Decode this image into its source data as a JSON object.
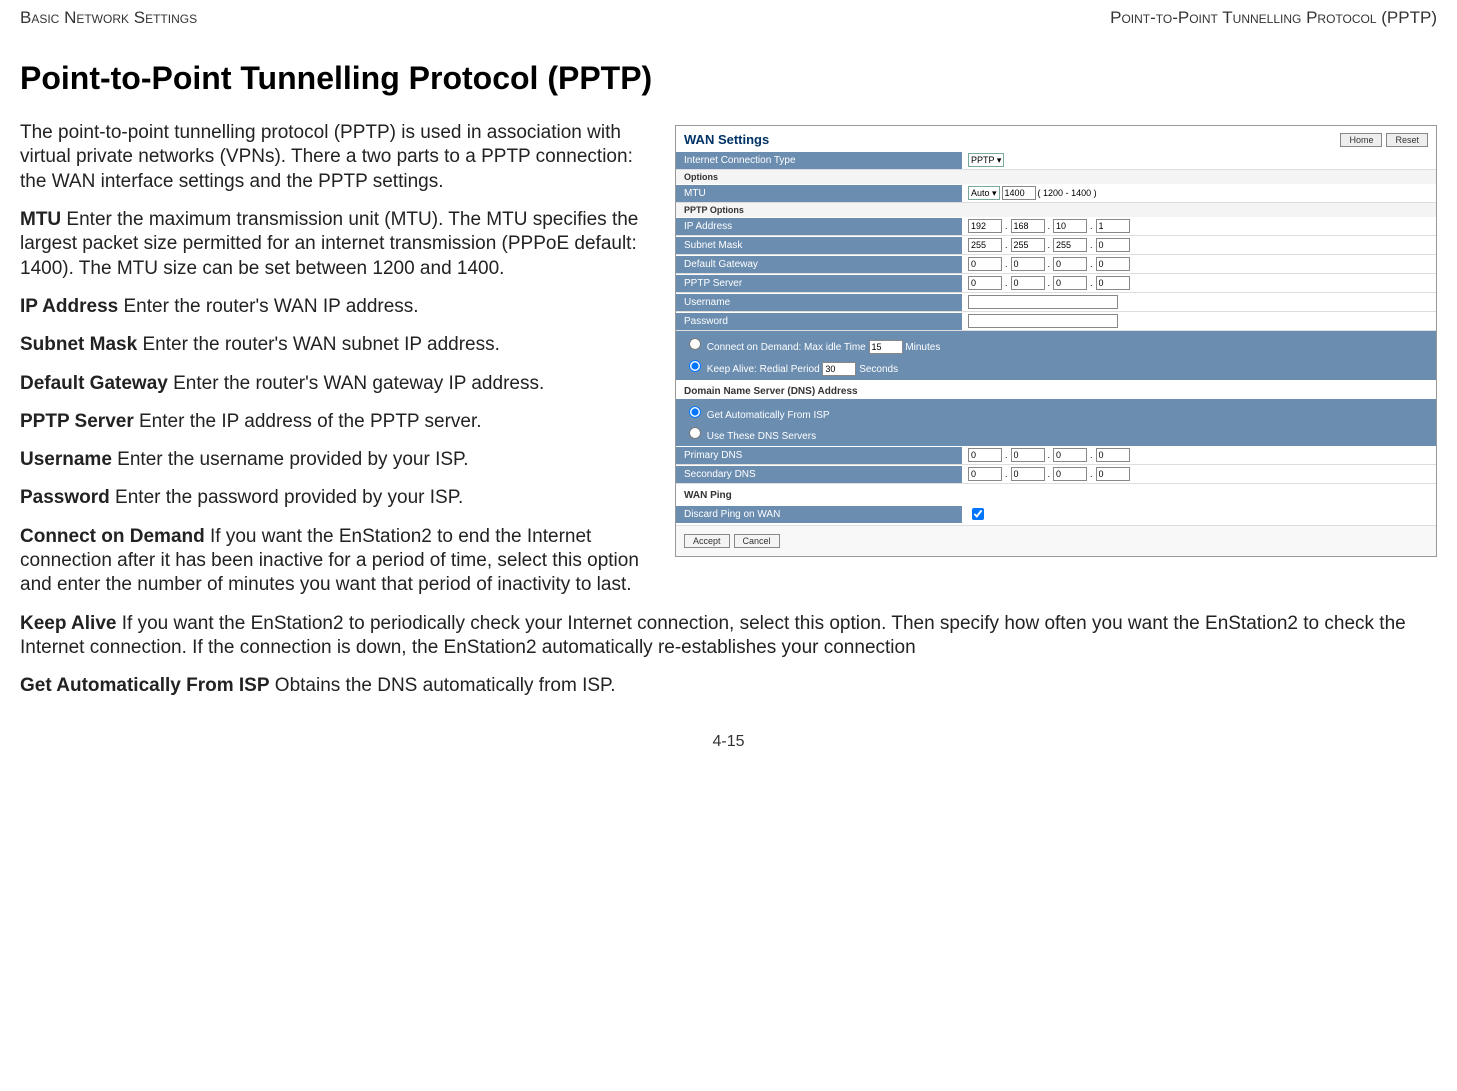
{
  "header": {
    "left": "Basic Network Settings",
    "right": "Point-to-Point Tunnelling Protocol (PPTP)"
  },
  "title": "Point-to-Point Tunnelling Protocol (PPTP)",
  "intro": "The point-to-point tunnelling protocol (PPTP) is used in association with virtual private networks (VPNs). There a two parts to a PPTP connection: the WAN interface settings and the PPTP settings.",
  "defs": {
    "mtu": {
      "term": "MTU",
      "text": "  Enter the maximum transmission unit (MTU). The MTU specifies the largest packet size permitted for an internet transmission (PPPoE default: 1400). The MTU size can be set between 1200 and 1400."
    },
    "ip": {
      "term": "IP Address",
      "text": "  Enter the router's WAN IP address."
    },
    "subnet": {
      "term": "Subnet Mask",
      "text": "  Enter the router's WAN subnet IP address."
    },
    "gw": {
      "term": "Default Gateway",
      "text": "  Enter the router's WAN gateway IP address."
    },
    "pptp": {
      "term": "PPTP Server",
      "text": "  Enter the IP address of the PPTP server."
    },
    "user": {
      "term": "Username",
      "text": "  Enter the username provided by your ISP."
    },
    "pass": {
      "term": "Password",
      "text": "  Enter the password provided by your ISP."
    },
    "cod": {
      "term": "Connect on Demand",
      "text": "  If you want the EnStation2 to end the Internet connection after it has been inactive for a period of time, select this option and enter the number of minutes you want that period of inactivity to last."
    },
    "ka": {
      "term": "Keep Alive",
      "text": "  If you want the EnStation2 to periodically check your Internet connection, select this option. Then specify how often you want the EnStation2 to check the Internet connection. If the connection is down, the EnStation2 automatically re-establishes your connection"
    },
    "auto": {
      "term": "Get Automatically From ISP",
      "text": "  Obtains the DNS automatically from ISP."
    }
  },
  "screenshot": {
    "title": "WAN Settings",
    "btn_home": "Home",
    "btn_reset": "Reset",
    "row_ict": "Internet Connection Type",
    "ict_value": "PPTP",
    "options_head": "Options",
    "row_mtu": "MTU",
    "mtu_mode": "Auto",
    "mtu_val": "1400",
    "mtu_range": "( 1200 - 1400 )",
    "pptp_head": "PPTP Options",
    "row_ip": "IP Address",
    "ip": [
      "192",
      "168",
      "10",
      "1"
    ],
    "row_mask": "Subnet Mask",
    "mask": [
      "255",
      "255",
      "255",
      "0"
    ],
    "row_gw": "Default Gateway",
    "gw": [
      "0",
      "0",
      "0",
      "0"
    ],
    "row_srv": "PPTP Server",
    "srv": [
      "0",
      "0",
      "0",
      "0"
    ],
    "row_user": "Username",
    "row_pass": "Password",
    "cod_label": "Connect on Demand: Max idle Time",
    "cod_val": "15",
    "cod_unit": "Minutes",
    "ka_label": "Keep Alive: Redial Period",
    "ka_val": "30",
    "ka_unit": "Seconds",
    "dns_head": "Domain Name Server (DNS) Address",
    "dns_auto": "Get Automatically From ISP",
    "dns_use": "Use These DNS Servers",
    "row_pdns": "Primary DNS",
    "pdns": [
      "0",
      "0",
      "0",
      "0"
    ],
    "row_sdns": "Secondary DNS",
    "sdns": [
      "0",
      "0",
      "0",
      "0"
    ],
    "wanping_head": "WAN Ping",
    "row_discard": "Discard Ping on WAN",
    "btn_accept": "Accept",
    "btn_cancel": "Cancel"
  },
  "page_num": "4-15"
}
